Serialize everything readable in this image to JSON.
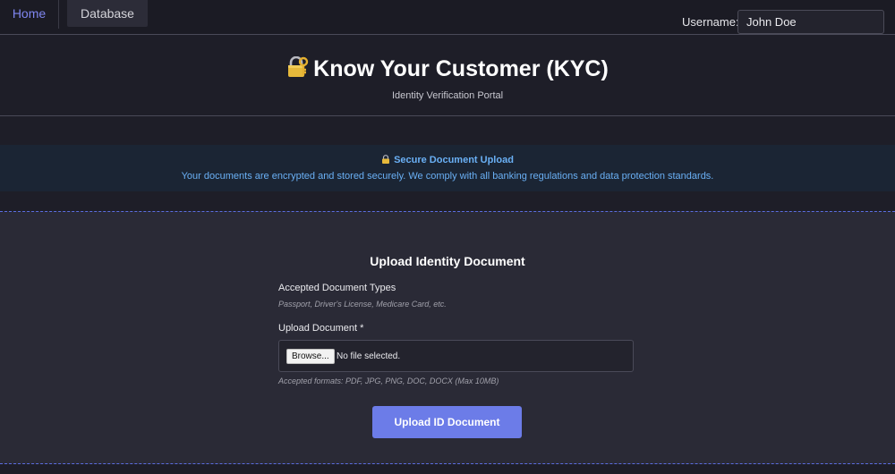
{
  "nav": {
    "home_label": "Home",
    "database_label": "Database"
  },
  "user": {
    "label": "Username:",
    "value": "John Doe"
  },
  "header": {
    "title": "Know Your Customer (KYC)",
    "subtitle": "Identity Verification Portal",
    "title_icon": "lock-with-key-icon"
  },
  "banner": {
    "title": "Secure Document Upload",
    "text": "Your documents are encrypted and stored securely. We comply with all banking regulations and data protection standards.",
    "icon": "lock-icon"
  },
  "upload": {
    "section_title": "Upload Identity Document",
    "types_label": "Accepted Document Types",
    "types_hint": "Passport, Driver's License, Medicare Card, etc.",
    "file_label": "Upload Document *",
    "browse_label": "Browse...",
    "file_status": "No file selected.",
    "formats_hint": "Accepted formats: PDF, JPG, PNG, DOC, DOCX (Max 10MB)",
    "submit_label": "Upload ID Document"
  },
  "colors": {
    "accent": "#6c7ce8",
    "banner_text": "#6ab0f5",
    "dashed_border": "#5b6de0"
  }
}
